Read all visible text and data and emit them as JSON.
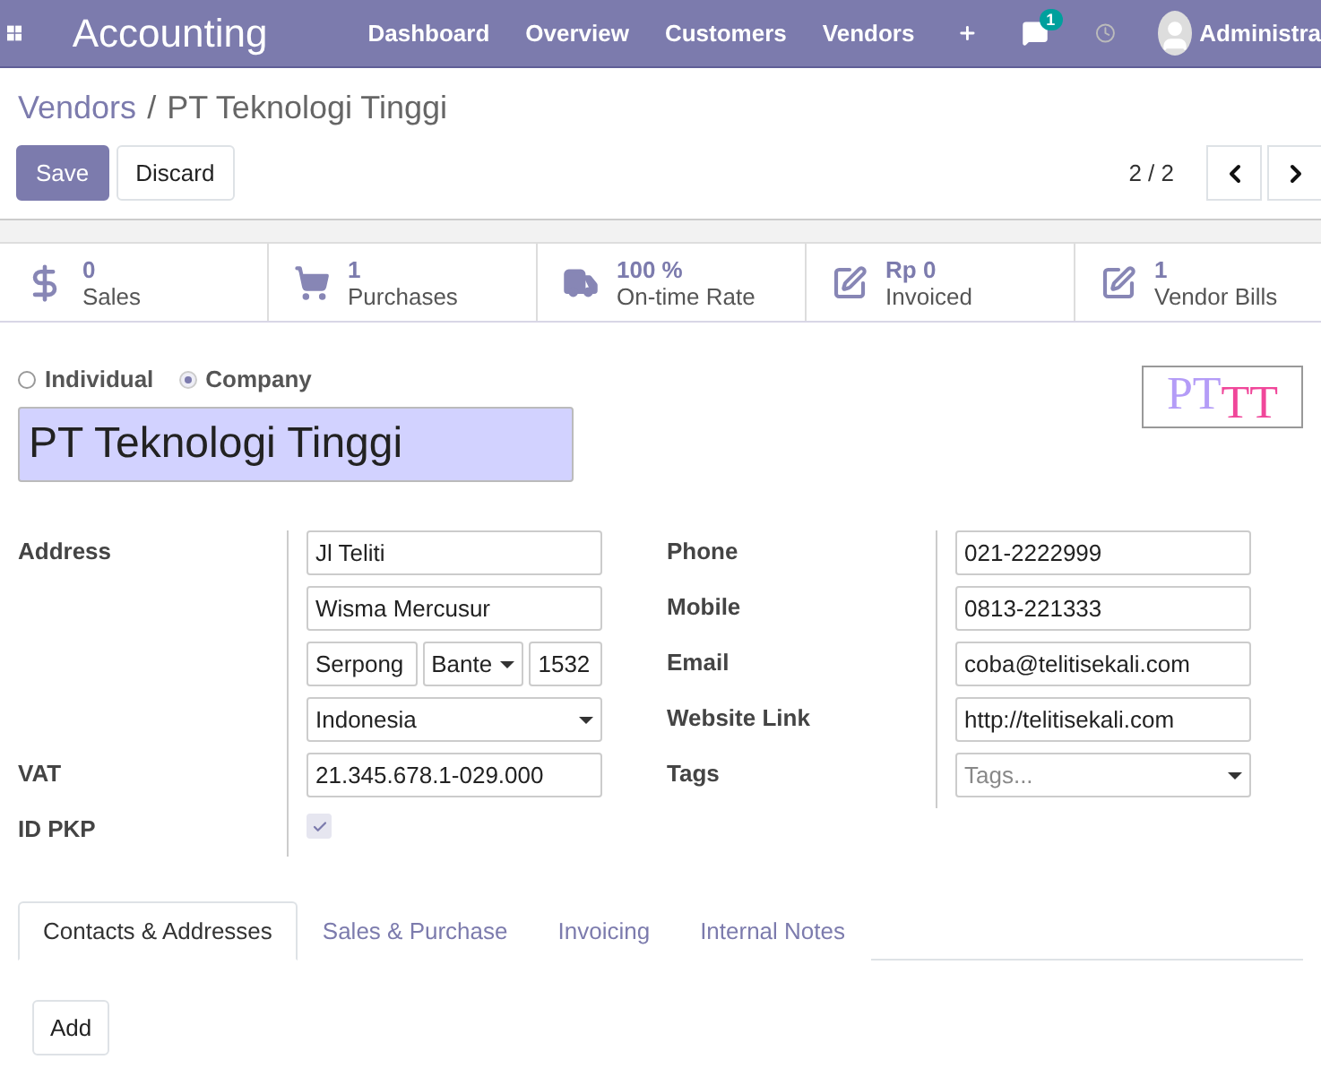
{
  "navbar": {
    "app_title": "Accounting",
    "menu": [
      "Dashboard",
      "Overview",
      "Customers",
      "Vendors"
    ],
    "messages_badge": "1",
    "user": "Administra"
  },
  "breadcrumb": {
    "parent": "Vendors",
    "separator": "/",
    "current": "PT Teknologi Tinggi"
  },
  "actions": {
    "save": "Save",
    "discard": "Discard",
    "pager": "2 / 2"
  },
  "stats": [
    {
      "kind": "dollar",
      "value": "0",
      "label": "Sales"
    },
    {
      "kind": "cart",
      "value": "1",
      "label": "Purchases"
    },
    {
      "kind": "truck",
      "value": "100 %",
      "label": "On-time Rate"
    },
    {
      "kind": "edit",
      "value": "Rp 0",
      "label": "Invoiced"
    },
    {
      "kind": "edit",
      "value": "1",
      "label": "Vendor Bills"
    }
  ],
  "company_type": [
    {
      "label": "Individual",
      "selected": false
    },
    {
      "label": "Company",
      "selected": true
    }
  ],
  "name": "PT Teknologi Tinggi",
  "logo": {
    "parts": [
      "PT",
      "TT"
    ]
  },
  "address": {
    "label": "Address",
    "street": "Jl Teliti",
    "street2": "Wisma Mercusur",
    "city": "Serpong",
    "state": "Bante",
    "zip": "1532",
    "country": "Indonesia"
  },
  "vat": {
    "label": "VAT",
    "value": "21.345.678.1-029.000"
  },
  "id_pkp": {
    "label": "ID PKP",
    "checked": true
  },
  "contact_fields": [
    {
      "kind": "text",
      "label": "Phone",
      "value": "021-2222999"
    },
    {
      "kind": "text",
      "label": "Mobile",
      "value": "0813-221333"
    },
    {
      "kind": "text",
      "label": "Email",
      "value": "coba@telitisekali.com"
    },
    {
      "kind": "text",
      "label": "Website Link",
      "value": "http://telitisekali.com"
    },
    {
      "kind": "select",
      "label": "Tags",
      "placeholder": "Tags..."
    }
  ],
  "tabs": [
    {
      "label": "Contacts & Addresses",
      "selected": true
    },
    {
      "label": "Sales & Purchase",
      "selected": false
    },
    {
      "label": "Invoicing",
      "selected": false
    },
    {
      "label": "Internal Notes",
      "selected": false
    }
  ],
  "add_button": "Add"
}
